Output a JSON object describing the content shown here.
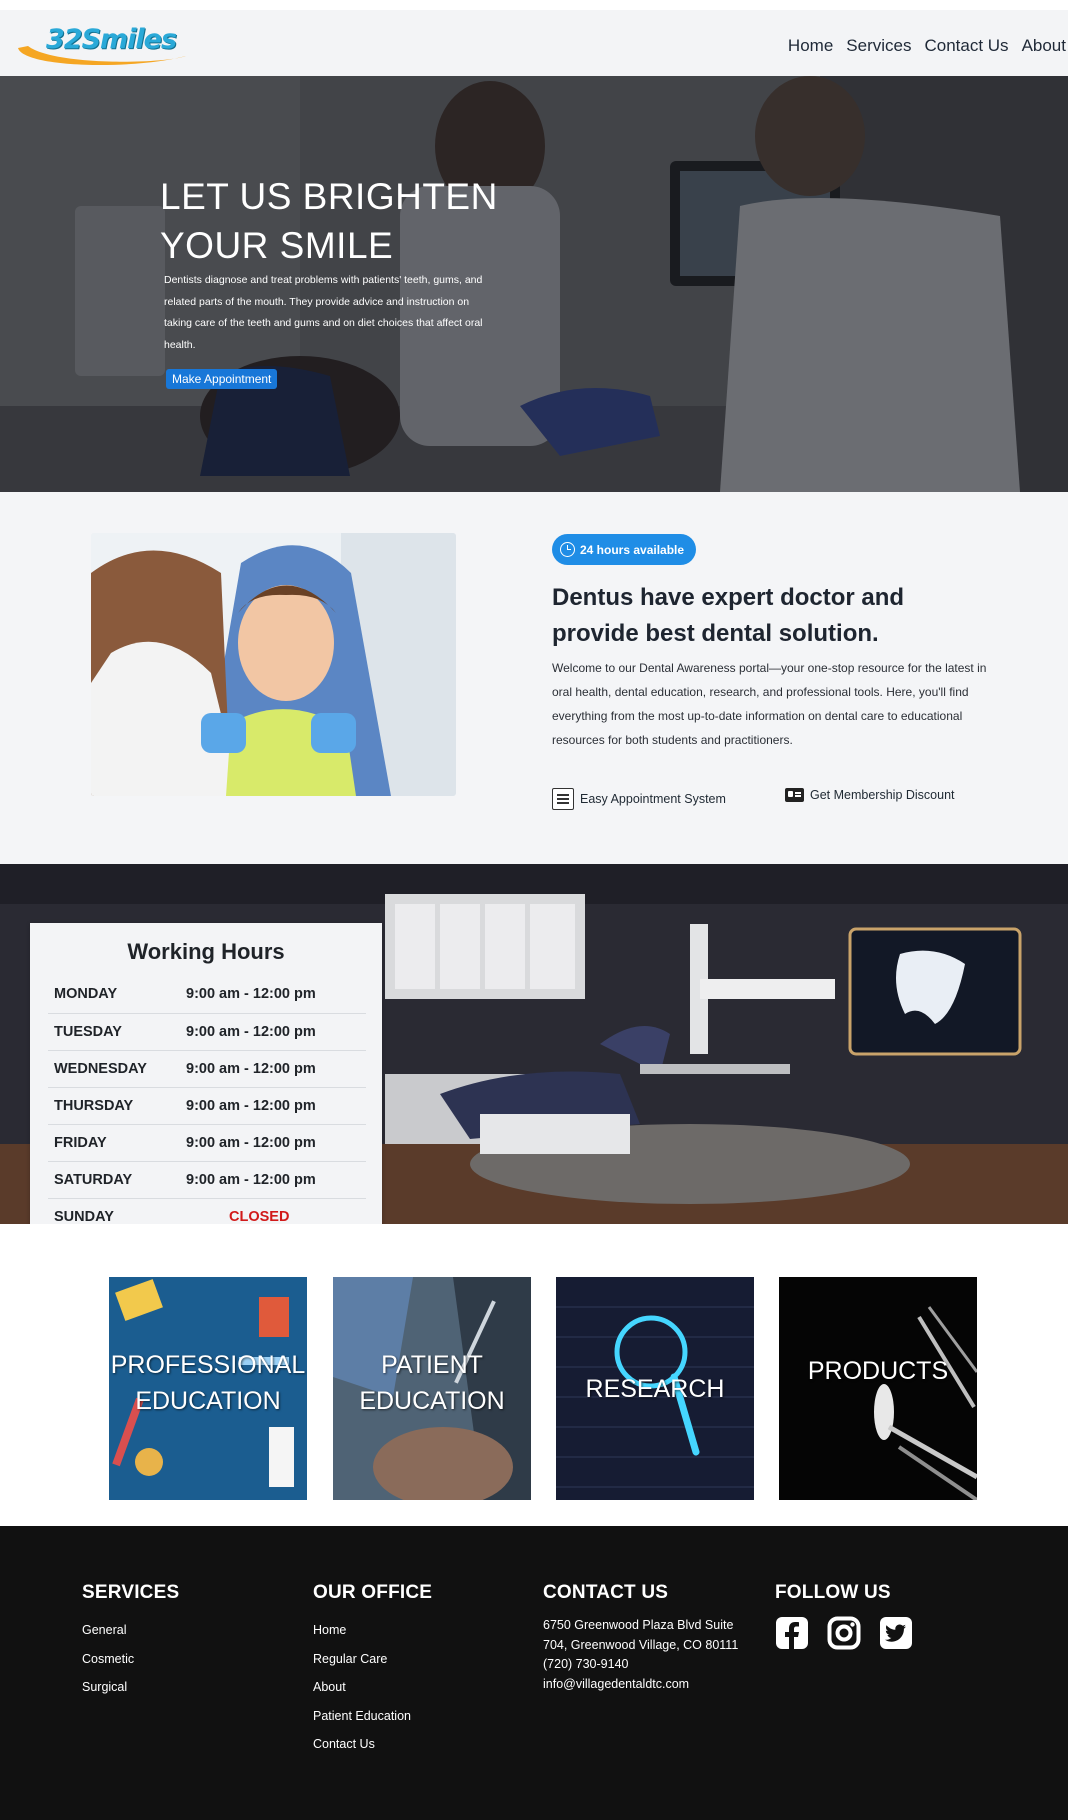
{
  "header": {
    "logo_text": "32Smiles",
    "nav": [
      {
        "label": "Home"
      },
      {
        "label": "Services"
      },
      {
        "label": "Contact Us"
      },
      {
        "label": "About"
      }
    ]
  },
  "hero": {
    "title_line1": "LET US BRIGHTEN",
    "title_line2": "YOUR SMILE",
    "description": "Dentists diagnose and treat problems with patients' teeth, gums, and related parts of the mouth. They provide advice and instruction on taking care of the teeth and gums and on diet choices that affect oral health.",
    "button_label": "Make Appointment"
  },
  "about": {
    "badge": "24 hours available",
    "heading": "Dentus have expert doctor and provide best dental solution.",
    "text": "Welcome to our Dental Awareness portal—your one-stop resource for the latest in oral health, dental education, research, and professional tools. Here, you'll find everything from the most up-to-date information on dental care to educational resources for both students and practitioners.",
    "features": [
      {
        "label": "Easy Appointment System",
        "icon": "document-icon"
      },
      {
        "label": "Get Membership Discount",
        "icon": "id-card-icon"
      }
    ]
  },
  "hours": {
    "title": "Working Hours",
    "rows": [
      {
        "day": "MONDAY",
        "time": "9:00 am - 12:00 pm"
      },
      {
        "day": "TUESDAY",
        "time": "9:00 am - 12:00 pm"
      },
      {
        "day": "WEDNESDAY",
        "time": "9:00 am - 12:00 pm"
      },
      {
        "day": "THURSDAY",
        "time": "9:00 am - 12:00 pm"
      },
      {
        "day": "FRIDAY",
        "time": "9:00 am - 12:00 pm"
      },
      {
        "day": "SATURDAY",
        "time": "9:00 am - 12:00 pm"
      },
      {
        "day": "SUNDAY",
        "time": "CLOSED"
      }
    ]
  },
  "categories": [
    {
      "line1": "PROFESSIONAL",
      "line2": "EDUCATION"
    },
    {
      "line1": "PATIENT",
      "line2": "EDUCATION"
    },
    {
      "line1": "RESEARCH",
      "line2": ""
    },
    {
      "line1": "PRODUCTS",
      "line2": ""
    }
  ],
  "footer": {
    "services": {
      "heading": "SERVICES",
      "links": [
        "General",
        "Cosmetic",
        "Surgical"
      ]
    },
    "office": {
      "heading": "OUR OFFICE",
      "links": [
        "Home",
        "Regular Care",
        "About",
        "Patient Education",
        "Contact Us"
      ]
    },
    "contact": {
      "heading": "CONTACT US",
      "address_line1": "6750 Greenwood Plaza Blvd Suite",
      "address_line2": "704, Greenwood Village, CO 80111",
      "phone": "(720) 730-9140",
      "email": "info@villagedentaldtc.com"
    },
    "follow": {
      "heading": "FOLLOW US",
      "icons": [
        "facebook-icon",
        "instagram-icon",
        "twitter-icon"
      ]
    }
  },
  "colors": {
    "accent_blue": "#1877d8",
    "badge_blue": "#1f8de6",
    "closed_red": "#d11a1a",
    "footer_bg": "#111111",
    "logo_orange": "#f5a623",
    "logo_blue": "#2aa9d8"
  }
}
